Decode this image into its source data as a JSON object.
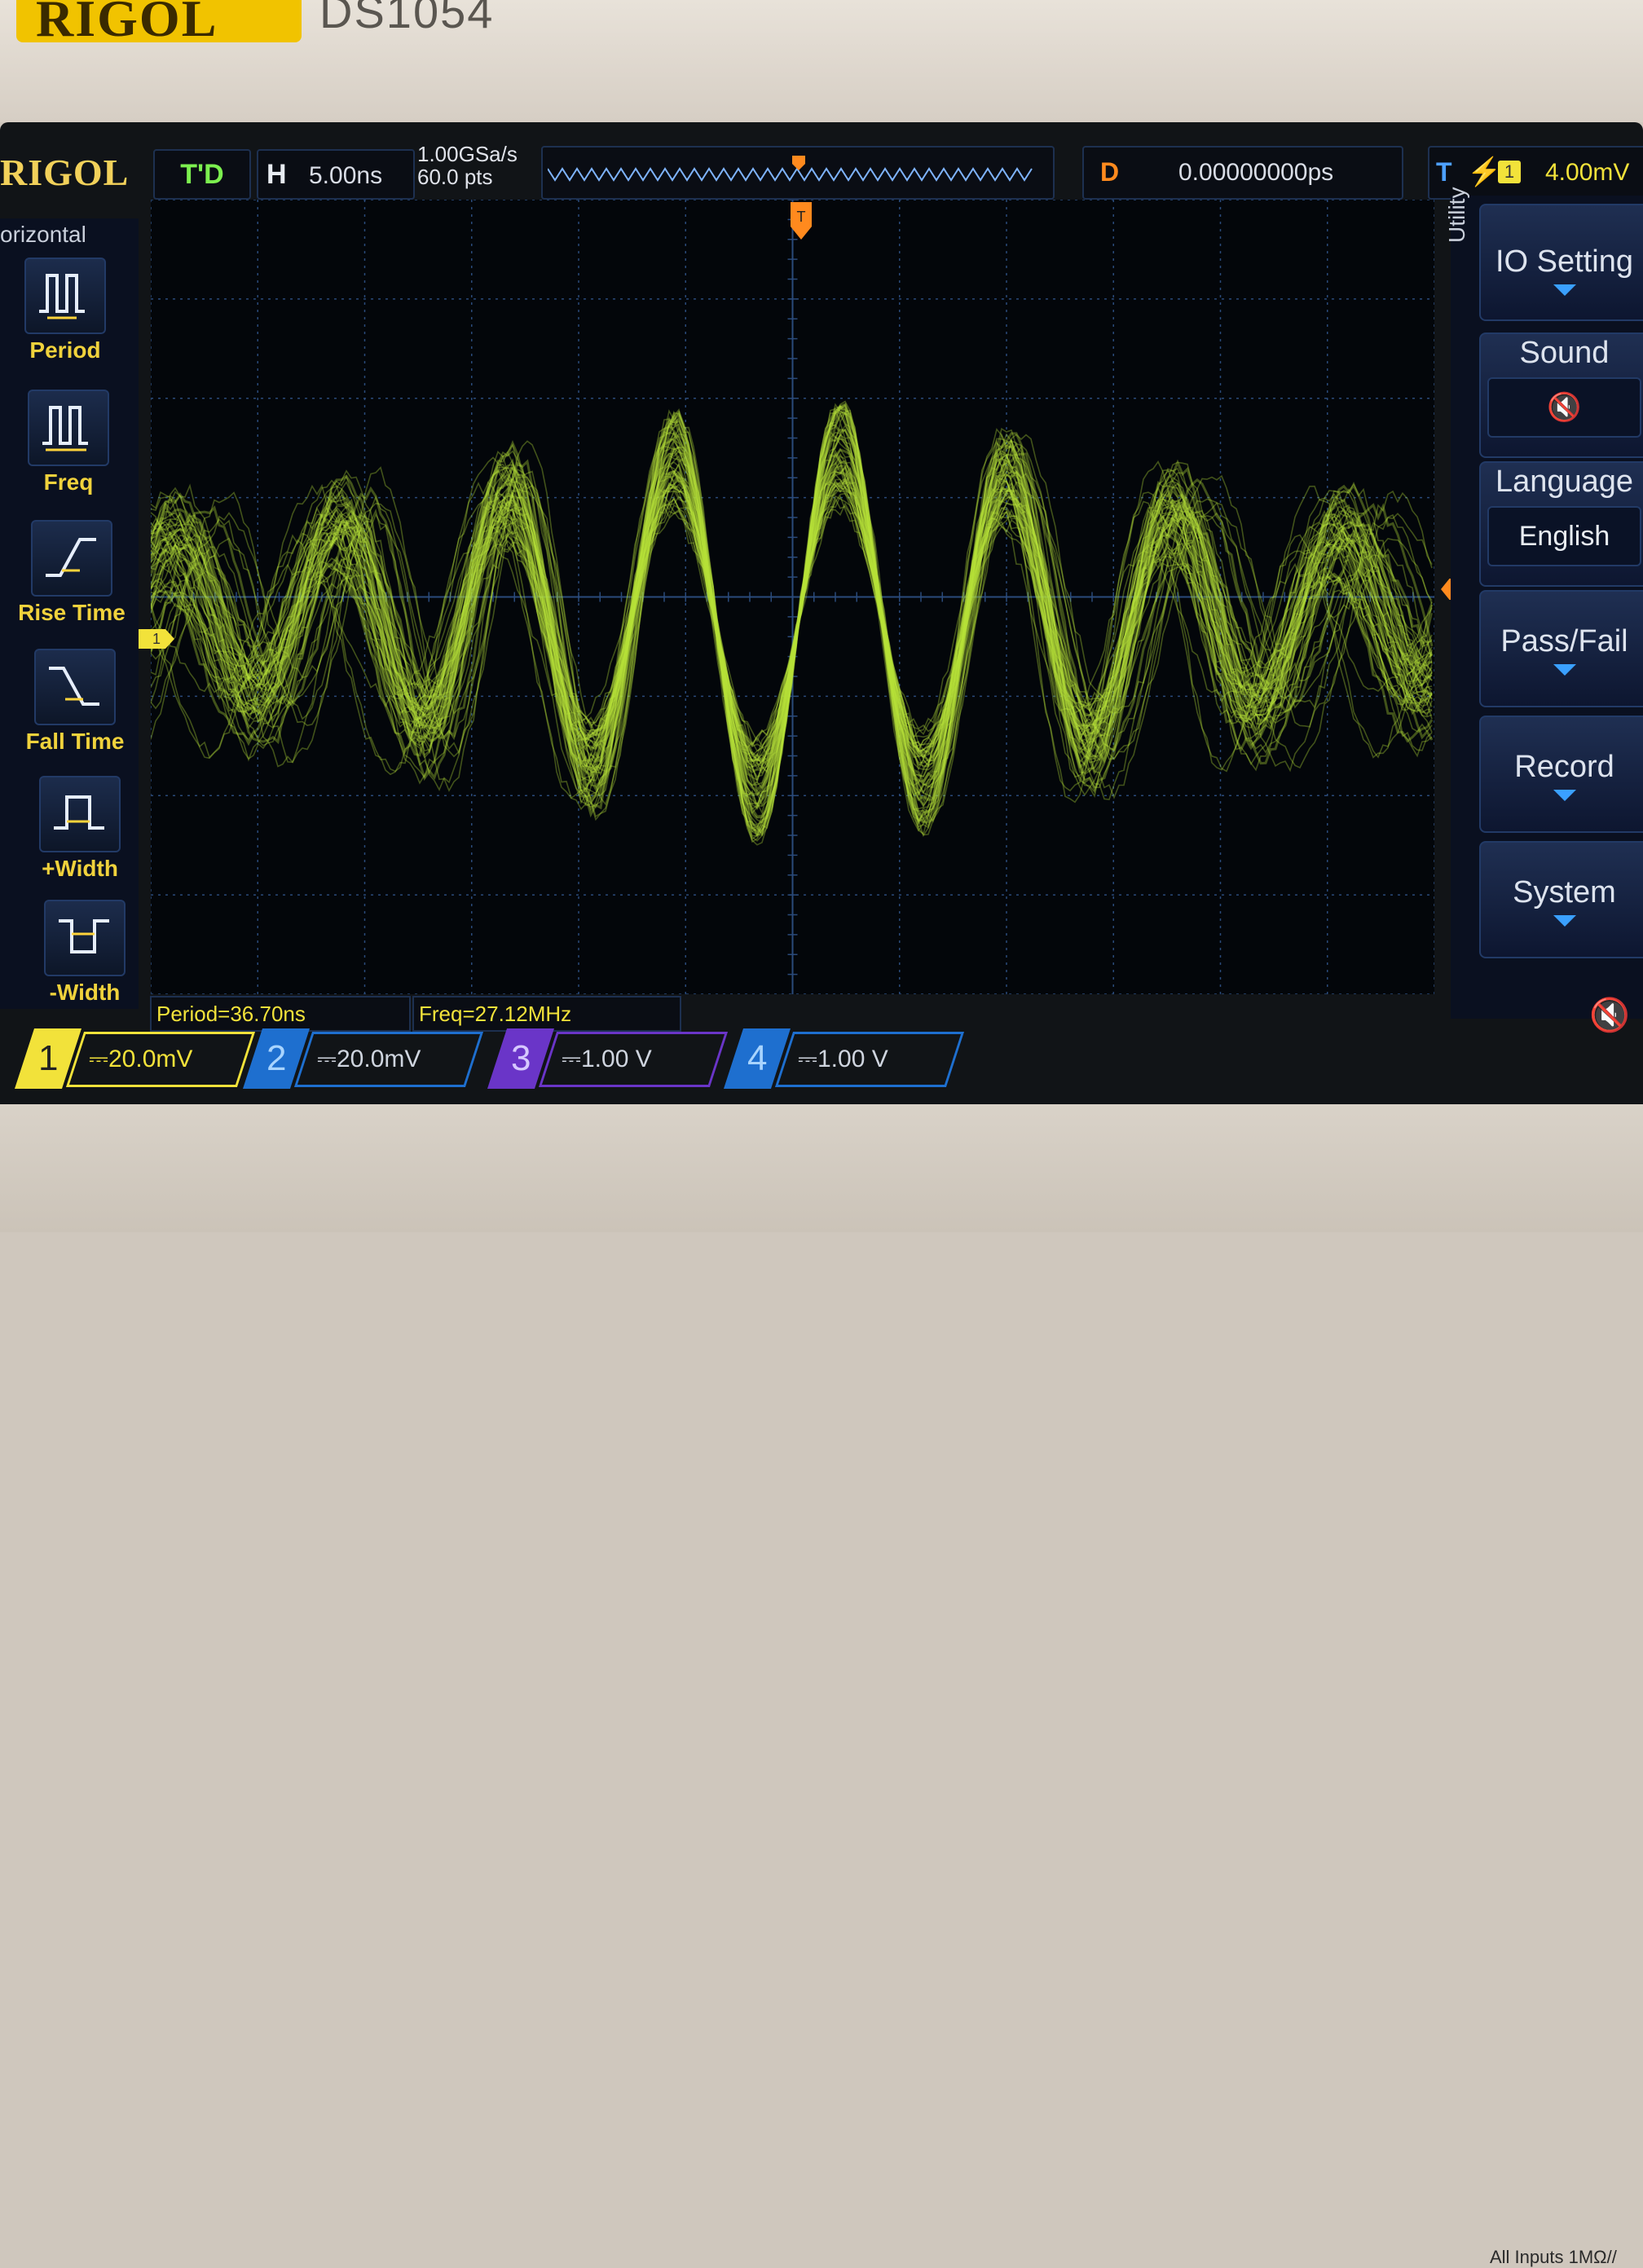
{
  "device": {
    "brand": "RIGOL",
    "model": "DS1054",
    "inputs_label": "All Inputs 1MΩ//"
  },
  "topbar": {
    "logo": "RIGOL",
    "run_state": "T'D",
    "horizontal_label": "H",
    "timebase": "5.00ns",
    "sample_rate": "1.00GSa/s",
    "memory_depth": "60.0 pts",
    "delay_label": "D",
    "delay_value": "0.00000000ps",
    "trigger_label": "T",
    "trigger_source": "1",
    "trigger_level": "4.00mV"
  },
  "left_menu": {
    "title": "orizontal",
    "items": [
      {
        "label": "Period",
        "icon": "period-icon"
      },
      {
        "label": "Freq",
        "icon": "freq-icon"
      },
      {
        "label": "Rise Time",
        "icon": "rise-time-icon"
      },
      {
        "label": "Fall Time",
        "icon": "fall-time-icon"
      },
      {
        "label": "+Width",
        "icon": "positive-width-icon"
      },
      {
        "label": "-Width",
        "icon": "negative-width-icon"
      }
    ]
  },
  "markers": {
    "ch1": "1",
    "trigger": "T"
  },
  "measurements": {
    "period": "Period=36.70ns",
    "freq": "Freq=27.12MHz"
  },
  "channels": [
    {
      "num": "1",
      "scale": "20.0mV"
    },
    {
      "num": "2",
      "scale": "20.0mV"
    },
    {
      "num": "3",
      "scale": "1.00 V"
    },
    {
      "num": "4",
      "scale": "1.00 V"
    }
  ],
  "right_menu": {
    "title": "Utility",
    "io_setting": "IO Setting",
    "sound": "Sound",
    "language": "Language",
    "language_value": "English",
    "pass_fail": "Pass/Fail",
    "record": "Record",
    "system": "System"
  },
  "colors": {
    "ch1": "#f2e23a",
    "trace": "#b6e23a",
    "trigger": "#ff8a1e",
    "grid": "#2a4a7a"
  }
}
